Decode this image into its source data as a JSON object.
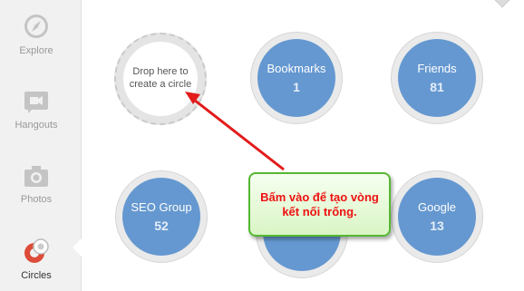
{
  "sidebar": {
    "items": [
      {
        "label": "Explore",
        "icon": "compass-icon"
      },
      {
        "label": "Hangouts",
        "icon": "video-camera-icon"
      },
      {
        "label": "Photos",
        "icon": "camera-icon"
      },
      {
        "label": "Circles",
        "icon": "circles-icon",
        "active": true
      }
    ]
  },
  "drop_zone": {
    "line1": "Drop here to",
    "line2": "create a circle"
  },
  "circles": [
    {
      "name": "Bookmarks",
      "count": "1"
    },
    {
      "name": "Friends",
      "count": "81"
    },
    {
      "name": "SEO Group",
      "count": "52"
    },
    {
      "name": "",
      "count": ""
    },
    {
      "name": "Google",
      "count": "13"
    }
  ],
  "annotation": {
    "line1": "Bấm vào để tạo vòng",
    "line2": "kết nối trống."
  },
  "colors": {
    "circle_fill": "#6598d0",
    "annotation_text": "#ee1111",
    "annotation_border": "#55b832",
    "arrow": "#e31b1b"
  }
}
